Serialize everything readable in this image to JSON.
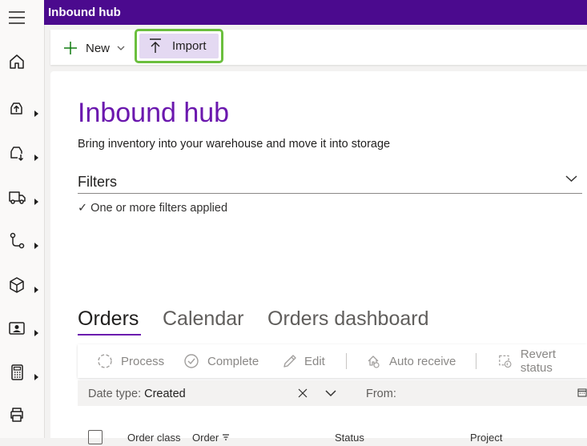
{
  "topbar": {
    "title": "Inbound hub"
  },
  "nav": {
    "items": [
      {
        "icon": "menu-icon"
      },
      {
        "icon": "home-icon"
      },
      {
        "icon": "upload-box-icon"
      },
      {
        "icon": "download-box-icon"
      },
      {
        "icon": "truck-icon"
      },
      {
        "icon": "flow-icon"
      },
      {
        "icon": "cube-icon"
      },
      {
        "icon": "contact-card-icon"
      },
      {
        "icon": "calculator-icon"
      },
      {
        "icon": "printer-icon"
      }
    ]
  },
  "commands": {
    "new_label": "New",
    "import_label": "Import"
  },
  "page": {
    "title": "Inbound hub",
    "description": "Bring inventory into your warehouse and move it into storage",
    "filters_label": "Filters",
    "filters_status": "✓ One or more filters applied"
  },
  "tabs": [
    {
      "label": "Orders",
      "active": true
    },
    {
      "label": "Calendar",
      "active": false
    },
    {
      "label": "Orders dashboard",
      "active": false
    }
  ],
  "actions": {
    "process": "Process",
    "complete": "Complete",
    "edit": "Edit",
    "auto_receive": "Auto receive",
    "revert_status": "Revert status"
  },
  "filter_row": {
    "date_type_label": "Date type:",
    "date_type_value": "Created",
    "from_label": "From:"
  },
  "grid": {
    "columns": [
      "Order class",
      "Order",
      "Status",
      "Project"
    ]
  },
  "colors": {
    "brand": "#4b0a8e",
    "title": "#6b18ae",
    "highlight": "#6bbf3e",
    "import_bg": "#e4d9f2",
    "add_icon": "#107c10"
  }
}
